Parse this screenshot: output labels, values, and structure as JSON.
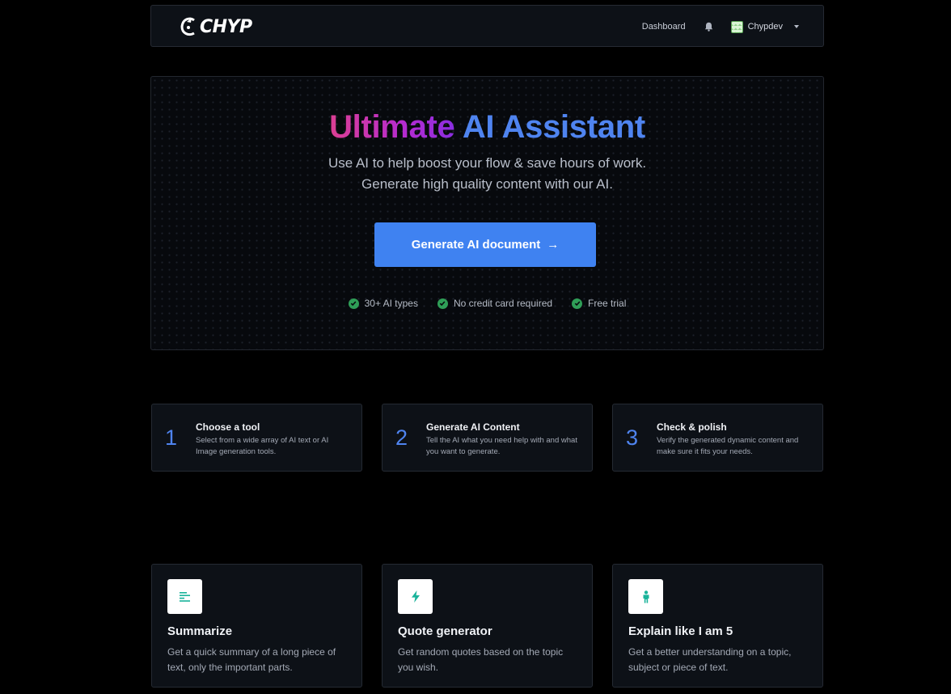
{
  "navbar": {
    "logo_text": "CHYP",
    "dashboard_link": "Dashboard",
    "user_name": "Chypdev"
  },
  "hero": {
    "title_highlight": "Ultimate",
    "title_rest": "AI Assistant",
    "subtitle": "Use AI to help boost your flow & save hours of work. Generate high quality content with our AI.",
    "cta_label": "Generate AI document",
    "cta_arrow": "→",
    "features": [
      "30+ AI types",
      "No credit card required",
      "Free trial"
    ]
  },
  "steps": [
    {
      "number": "1",
      "title": "Choose a tool",
      "desc": "Select from a wide array of AI text or AI Image generation tools."
    },
    {
      "number": "2",
      "title": "Generate AI Content",
      "desc": "Tell the AI what you need help with and what you want to generate."
    },
    {
      "number": "3",
      "title": "Check & polish",
      "desc": "Verify the generated dynamic content and make sure it fits your needs."
    }
  ],
  "tools": [
    {
      "icon": "text-lines-icon",
      "title": "Summarize",
      "desc": "Get a quick summary of a long piece of text, only the important parts."
    },
    {
      "icon": "lightning-icon",
      "title": "Quote generator",
      "desc": "Get random quotes based on the topic you wish."
    },
    {
      "icon": "child-icon",
      "title": "Explain like I am 5",
      "desc": "Get a better understanding on a topic, subject or piece of text."
    }
  ],
  "colors": {
    "background": "#000000",
    "card": "#0d1117",
    "accent_blue": "#3f82f1",
    "gradient_pink": "#dc3f93",
    "gradient_purple": "#8a2ee0",
    "check_green": "#2f9e57",
    "icon_teal": "#19b39a"
  }
}
